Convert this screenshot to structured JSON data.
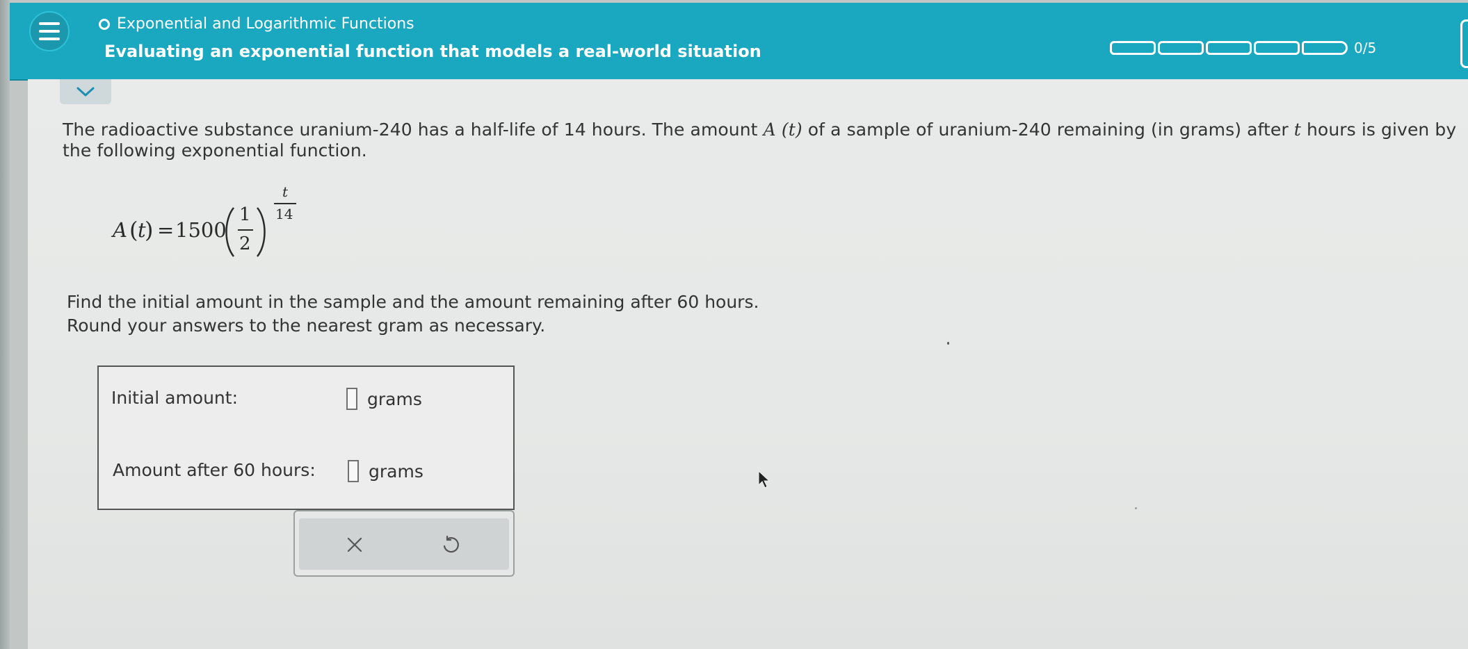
{
  "header": {
    "topic_title": "Exponential and Logarithmic Functions",
    "lesson_title": "Evaluating an exponential function that models a real-world situation",
    "progress": {
      "completed": 0,
      "total": 5,
      "count_text": "0/5"
    },
    "accent_color": "#1aa8c0"
  },
  "problem": {
    "intro_part1": "The radioactive substance uranium-240 has a half-life of 14 hours. The amount ",
    "intro_func": "A",
    "intro_var": "t",
    "intro_part2": " of a sample of uranium-240 remaining (in grams) after ",
    "intro_t": "t",
    "intro_part3": " hours is given by",
    "intro_line2": "the following exponential function.",
    "formula": {
      "func": "A",
      "var": "t",
      "equals": "=",
      "coefficient": "1500",
      "base_numerator": "1",
      "base_denominator": "2",
      "exponent_numerator": "t",
      "exponent_denominator": "14"
    },
    "instruction_line1": "Find the initial amount in the sample and the amount remaining after 60 hours.",
    "instruction_line2": "Round your answers to the nearest gram as necessary."
  },
  "answers": {
    "initial_label": "Initial amount:",
    "initial_value": "",
    "initial_unit": "grams",
    "after_label": "Amount after 60 hours:",
    "after_value": "",
    "after_unit": "grams"
  },
  "actions": {
    "clear_icon": "close-icon",
    "undo_icon": "undo-icon"
  }
}
